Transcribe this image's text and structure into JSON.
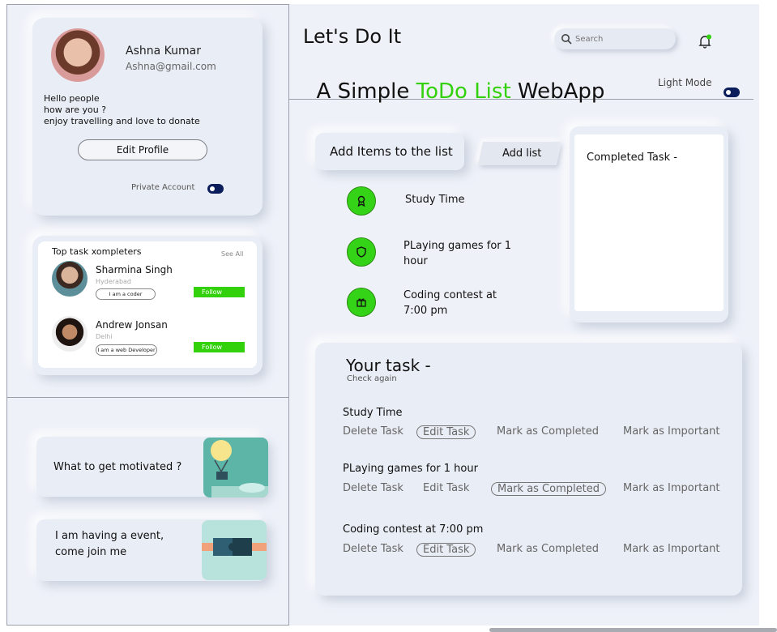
{
  "profile": {
    "name": "Ashna Kumar",
    "email": "Ashna@gmail.com",
    "bio": [
      "Hello people",
      "how are you ?",
      "enjoy travelling and love to donate"
    ],
    "edit_label": "Edit Profile",
    "private_label": "Private Account"
  },
  "completers": {
    "title": "Top task xompleters",
    "see_all": "See All",
    "people": [
      {
        "name": "Sharmina Singh",
        "city": "Hyderabad",
        "tag": "I am a coder",
        "follow": "Follow"
      },
      {
        "name": "Andrew Jonsan",
        "city": "Delhi",
        "tag": "I am a web Developer",
        "follow": "Follow"
      }
    ]
  },
  "promos": [
    "What to get motivated ?",
    "I am having a event,\ncome join me"
  ],
  "header": {
    "title1": "Let's Do It",
    "title2_a": "A Simple ",
    "title2_accent": "ToDo List",
    "title2_b": " WebApp",
    "search_placeholder": "Search",
    "mode_label": "Light Mode"
  },
  "add": {
    "title": "Add Items to the list",
    "button": "Add list",
    "items": [
      {
        "label": "Study Time",
        "icon": "award-icon"
      },
      {
        "label": "PLaying games for 1 hour",
        "icon": "shield-icon"
      },
      {
        "label": "Coding contest at 7:00 pm",
        "icon": "gift-icon"
      }
    ]
  },
  "completed": {
    "title": "Completed Task -"
  },
  "tasks": {
    "title": "Your task -",
    "subtitle": "Check again",
    "actions": {
      "delete": "Delete Task",
      "edit": "Edit Task",
      "complete": "Mark as Completed",
      "important": "Mark as Important"
    },
    "rows": [
      "Study Time",
      "PLaying games for 1 hour",
      "Coding contest at 7:00 pm"
    ]
  },
  "colors": {
    "accent": "#32d10b",
    "toggle": "#0b1d5a",
    "panel": "#eef1f8"
  }
}
